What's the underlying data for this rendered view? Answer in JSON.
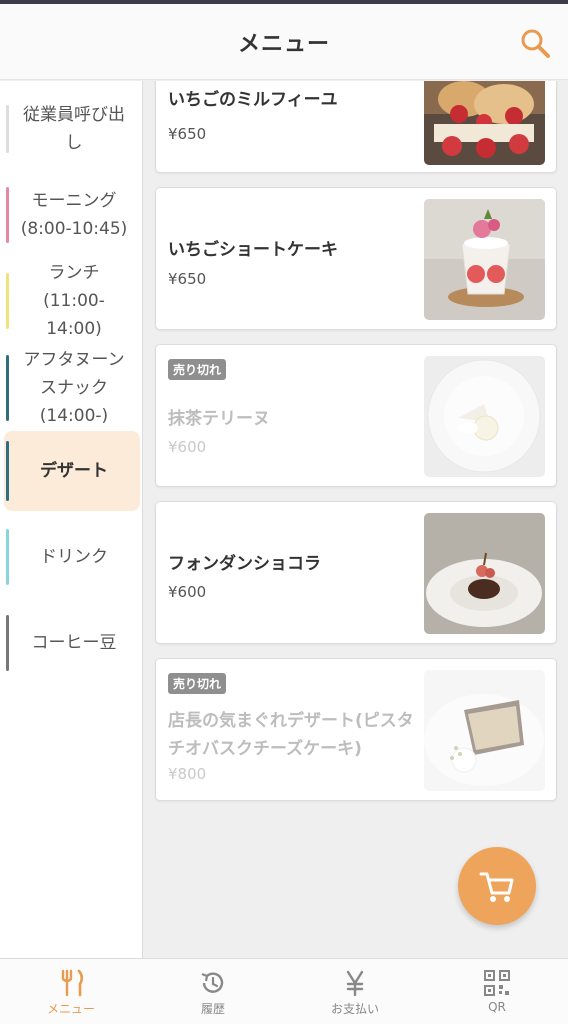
{
  "header": {
    "title": "メニュー",
    "search_icon": "search-icon"
  },
  "sidebar": {
    "items": [
      {
        "label": "従業員呼び出し",
        "color": "#dddddd",
        "active": false
      },
      {
        "label": "モーニング(8:00-10:45)",
        "color": "#e58aa1",
        "active": false
      },
      {
        "label": "ランチ(11:00-14:00)",
        "color": "#f1e27a",
        "active": false
      },
      {
        "label": "アフタヌーンスナック(14:00-)",
        "color": "#2f6e7e",
        "active": false
      },
      {
        "label": "デザート",
        "color": "#2f6e7e",
        "active": true
      },
      {
        "label": "ドリンク",
        "color": "#8ad3e0",
        "active": false
      },
      {
        "label": "コーヒー豆",
        "color": "#777777",
        "active": false
      }
    ]
  },
  "menu_items": [
    {
      "name": "いちごのミルフィーユ",
      "price": "¥650",
      "sold_out": false
    },
    {
      "name": "いちごショートケーキ",
      "price": "¥650",
      "sold_out": false
    },
    {
      "name": "抹茶テリーヌ",
      "price": "¥600",
      "sold_out": true,
      "badge": "売り切れ"
    },
    {
      "name": "フォンダンショコラ",
      "price": "¥600",
      "sold_out": false
    },
    {
      "name": "店長の気まぐれデザート(ピスタチオバスクチーズケーキ)",
      "price": "¥800",
      "sold_out": true,
      "badge": "売り切れ"
    }
  ],
  "cart": {
    "icon": "cart-icon",
    "color": "#eea45a"
  },
  "bottom_nav": [
    {
      "label": "メニュー",
      "icon": "fork-knife-icon",
      "active": true
    },
    {
      "label": "履歴",
      "icon": "history-icon",
      "active": false
    },
    {
      "label": "お支払い",
      "icon": "yen-icon",
      "active": false
    },
    {
      "label": "QR",
      "icon": "qr-code-icon",
      "active": false
    }
  ],
  "colors": {
    "accent": "#e89a4e",
    "active_category_bg": "#fcebd9"
  }
}
